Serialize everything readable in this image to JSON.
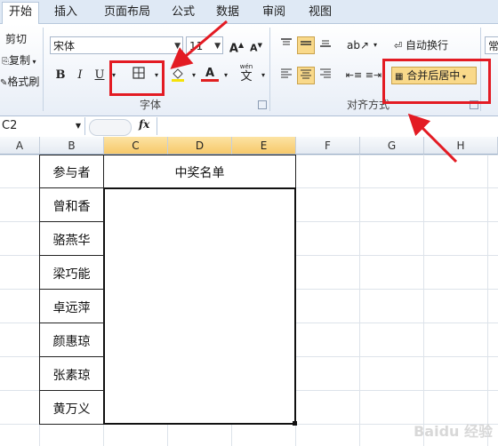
{
  "tabs": [
    {
      "label": "开始",
      "active": true
    },
    {
      "label": "插入"
    },
    {
      "label": "页面布局"
    },
    {
      "label": "公式"
    },
    {
      "label": "数据"
    },
    {
      "label": "审阅"
    },
    {
      "label": "视图"
    }
  ],
  "clipboard": {
    "cut": "剪切",
    "copy": "复制",
    "format_painter": "格式刷"
  },
  "font": {
    "name": "宋体",
    "size": "11",
    "bold": "B",
    "italic": "I",
    "underline": "U",
    "wen": "wén",
    "group_label": "字体"
  },
  "alignment": {
    "wrap_text": "自动换行",
    "merge_center": "合并后居中",
    "group_label": "对齐方式"
  },
  "number": {
    "format": "常"
  },
  "formula_bar": {
    "name_box": "C2",
    "fx": "fx",
    "value": ""
  },
  "columns": [
    "A",
    "B",
    "C",
    "D",
    "E",
    "F",
    "G",
    "H"
  ],
  "sheet": {
    "header_b": "参与者",
    "header_merged": "中奖名单",
    "participants": [
      "曾和香",
      "骆燕华",
      "梁巧能",
      "卓远萍",
      "颜惠琼",
      "张素琼",
      "黄万义"
    ]
  },
  "colors": {
    "highlight": "#e31b23",
    "accent": "#f7c96a"
  },
  "watermark": "Baidu 经验"
}
